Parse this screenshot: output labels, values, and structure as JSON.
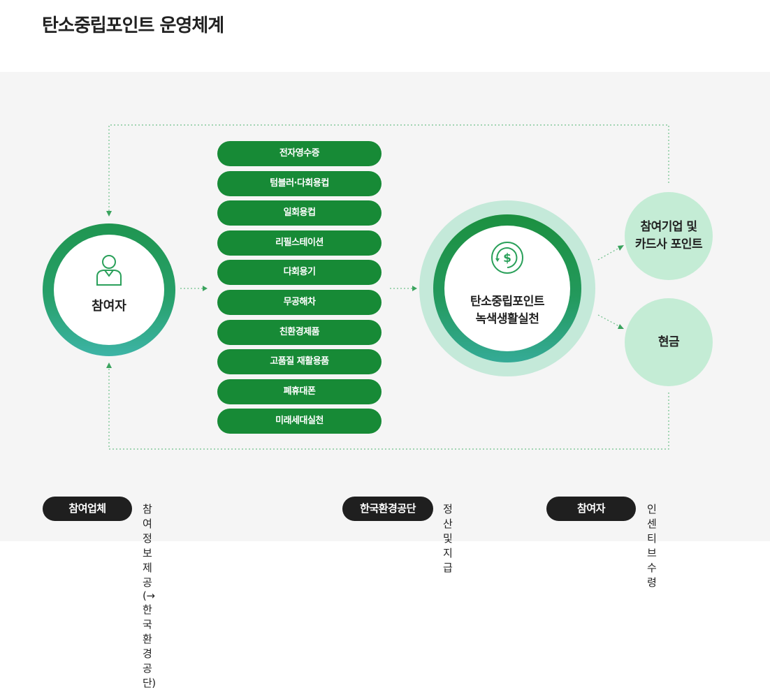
{
  "page": {
    "title": "탄소중립포인트 운영체계"
  },
  "participant": {
    "label": "참여자",
    "icon": "person-icon"
  },
  "activities": [
    "전자영수증",
    "텀블러·다회용컵",
    "일회용컵",
    "리필스테이션",
    "다회용기",
    "무공해차",
    "친환경제품",
    "고품질 재활용품",
    "폐휴대폰",
    "미래세대실천"
  ],
  "hub": {
    "icon": "dollar-coin-icon",
    "title": "탄소중립포인트",
    "subtitle": "녹색생활실천"
  },
  "rewards": {
    "points": {
      "line1": "참여기업 및",
      "line2": "카드사 포인트"
    },
    "cash": {
      "label": "현금"
    }
  },
  "legend": [
    {
      "badge": "참여업체",
      "text": "참여 정보 제공 (→한국환경공단)"
    },
    {
      "badge": "한국환경공단",
      "text": "정산 및 지급"
    },
    {
      "badge": "참여자",
      "text": "인센티브 수령"
    }
  ],
  "colors": {
    "pill_green": "#178a36",
    "ring_green": "#1f9550",
    "ring_teal": "#3db4a6",
    "light_mint": "#c4ecd5",
    "badge_dark": "#1f1f1f",
    "panel_bg": "#f5f5f5"
  }
}
